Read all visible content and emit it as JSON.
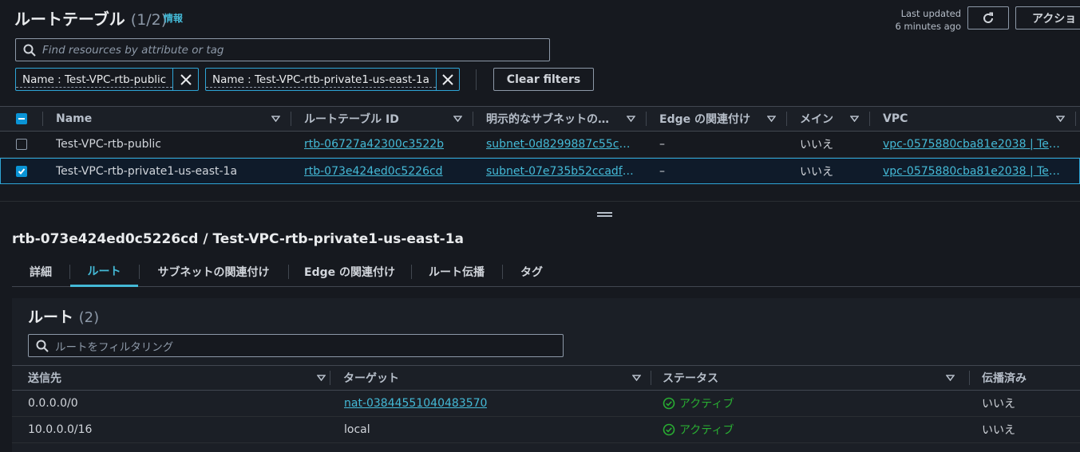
{
  "header": {
    "title": "ルートテーブル",
    "count": "(1/2)",
    "info_link": "情報",
    "last_updated_line1": "Last updated",
    "last_updated_line2": "6 minutes ago",
    "actions_label": "アクショ"
  },
  "filter": {
    "search_placeholder": "Find resources by attribute or tag",
    "chips": [
      {
        "label": "Name : Test-VPC-rtb-public"
      },
      {
        "label": "Name : Test-VPC-rtb-private1-us-east-1a"
      }
    ],
    "clear_label": "Clear filters"
  },
  "table": {
    "columns": [
      "Name",
      "ルートテーブル ID",
      "明示的なサブネットの…",
      "Edge の関連付け",
      "メイン",
      "VPC"
    ],
    "rows": [
      {
        "selected": false,
        "name": "Test-VPC-rtb-public",
        "id": "rtb-06727a42300c3522b",
        "subnet": "subnet-0d8299887c55c9…",
        "edge": "–",
        "main": "いいえ",
        "vpc": "vpc-0575880cba81e2038 | Test…"
      },
      {
        "selected": true,
        "name": "Test-VPC-rtb-private1-us-east-1a",
        "id": "rtb-073e424ed0c5226cd",
        "subnet": "subnet-07e735b52ccadfc…",
        "edge": "–",
        "main": "いいえ",
        "vpc": "vpc-0575880cba81e2038 | Test…"
      }
    ]
  },
  "detail": {
    "title": "rtb-073e424ed0c5226cd / Test-VPC-rtb-private1-us-east-1a",
    "tabs": [
      "詳細",
      "ルート",
      "サブネットの関連付け",
      "Edge の関連付け",
      "ルート伝播",
      "タグ"
    ],
    "active_tab": "ルート",
    "routes": {
      "title": "ルート",
      "count": "(2)",
      "search_placeholder": "ルートをフィルタリング",
      "columns": [
        "送信先",
        "ターゲット",
        "ステータス",
        "伝播済み"
      ],
      "rows": [
        {
          "destination": "0.0.0.0/0",
          "target": "nat-03844551040483570",
          "target_link": true,
          "status": "アクティブ",
          "propagated": "いいえ"
        },
        {
          "destination": "10.0.0.0/16",
          "target": "local",
          "target_link": false,
          "status": "アクティブ",
          "propagated": "いいえ"
        }
      ]
    }
  },
  "colors": {
    "background": "#16191f",
    "link": "#44b9d6",
    "accent": "#0a94d6",
    "status_ok": "#29ad32"
  }
}
